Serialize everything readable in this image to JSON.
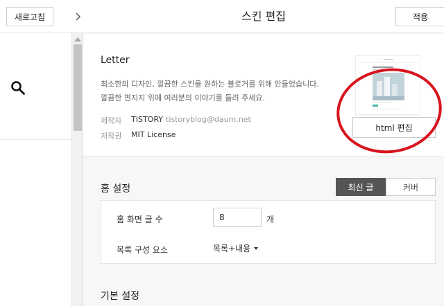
{
  "left_pane": {
    "refresh_label": "새로고침",
    "search_icon": "search-icon",
    "collapse_icon": "chevron-right-icon"
  },
  "header": {
    "title": "스킨 편집",
    "apply_label": "적용"
  },
  "skin": {
    "name": "Letter",
    "description_line1": "최소한의 디자인, 깔끔한 스킨을 원하는 블로거를 위해 만들었습니다.",
    "description_line2": "깔끔한 편지지 위에 여러분의 이야기를 들려 주세요.",
    "maker_label": "제작자",
    "maker_name": "TISTORY",
    "maker_email": "tistoryblog@daum.net",
    "copyright_label": "저작권",
    "copyright_value": "MIT License",
    "html_edit_label": "html 편집",
    "annotation_color": "#d8141e"
  },
  "home_settings": {
    "title": "홈 설정",
    "tabs": [
      {
        "label": "최신 글",
        "active": true
      },
      {
        "label": "커버",
        "active": false
      }
    ],
    "post_count_label": "홈 화면 글 수",
    "post_count_value": "8",
    "post_count_unit": "개",
    "list_component_label": "목록 구성 요소",
    "list_component_value": "목록+내용"
  },
  "basic_settings": {
    "title": "기본 설정"
  }
}
